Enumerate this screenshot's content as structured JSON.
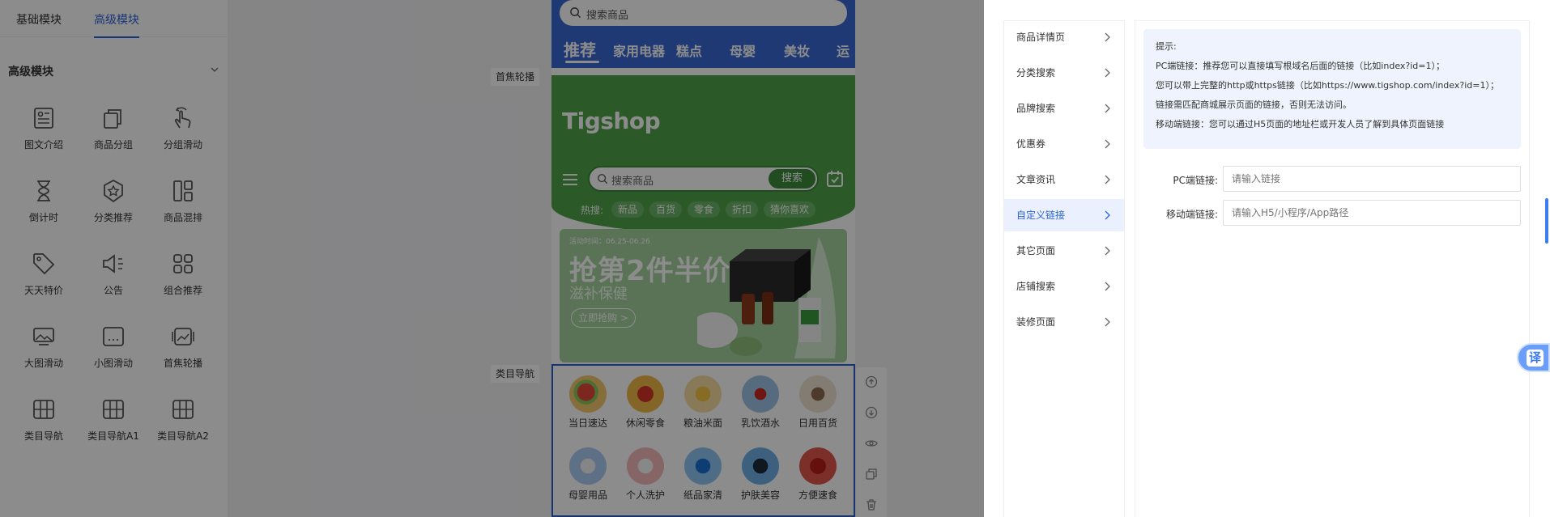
{
  "left": {
    "tabs": [
      "基础模块",
      "高级模块"
    ],
    "section_title": "高级模块",
    "components": [
      "图文介绍",
      "商品分组",
      "分组滑动",
      "倒计时",
      "分类推荐",
      "商品混排",
      "天天特价",
      "公告",
      "组合推荐",
      "大图滑动",
      "小图滑动",
      "首焦轮播",
      "类目导航",
      "类目导航A1",
      "类目导航A2"
    ]
  },
  "phone": {
    "search_placeholder": "搜索商品",
    "categories": [
      "推荐",
      "家用电器",
      "糕点",
      "母婴",
      "美妆",
      "运"
    ],
    "logo": "Tigshop",
    "green_search_placeholder": "搜索商品",
    "search_button": "搜索",
    "hot_label": "热搜:",
    "hot_chips": [
      "新品",
      "百货",
      "零食",
      "折扣",
      "猜你喜欢"
    ],
    "banner": {
      "date": "活动时间：06.25-06.26",
      "title": "抢第2件半价",
      "subtitle": "滋补保健",
      "button": "立即抢购 >"
    },
    "nav_items": [
      "当日速达",
      "休闲零食",
      "粮油米面",
      "乳饮酒水",
      "日用百货",
      "母婴用品",
      "个人洗护",
      "纸品家清",
      "护肤美容",
      "方便速食"
    ]
  },
  "canvas_tags": [
    "首焦轮播",
    "类目导航"
  ],
  "right": {
    "menu": [
      "商品详情页",
      "分类搜索",
      "品牌搜索",
      "优惠券",
      "文章资讯",
      "自定义链接",
      "其它页面",
      "店铺搜索",
      "装修页面"
    ],
    "active_menu": "自定义链接",
    "tip_lines": [
      "提示:",
      "PC端链接：推荐您可以直接填写根域名后面的链接（比如index?id=1）；",
      "您可以带上完整的http或https链接（比如https://www.tigshop.com/index?id=1）；",
      "链接需匹配商城展示页面的链接，否则无法访问。",
      "移动端链接：您可以通过H5页面的地址栏或开发人员了解到具体页面链接"
    ],
    "pc_label": "PC端链接:",
    "pc_placeholder": "请输入链接",
    "mobile_label": "移动端链接:",
    "mobile_placeholder": "请输入H5/小程序/App路径"
  },
  "translate_label": "译",
  "colors": {
    "accent": "#2b63d9",
    "topbar": "#3a68d6",
    "green": "#4fa44a"
  }
}
